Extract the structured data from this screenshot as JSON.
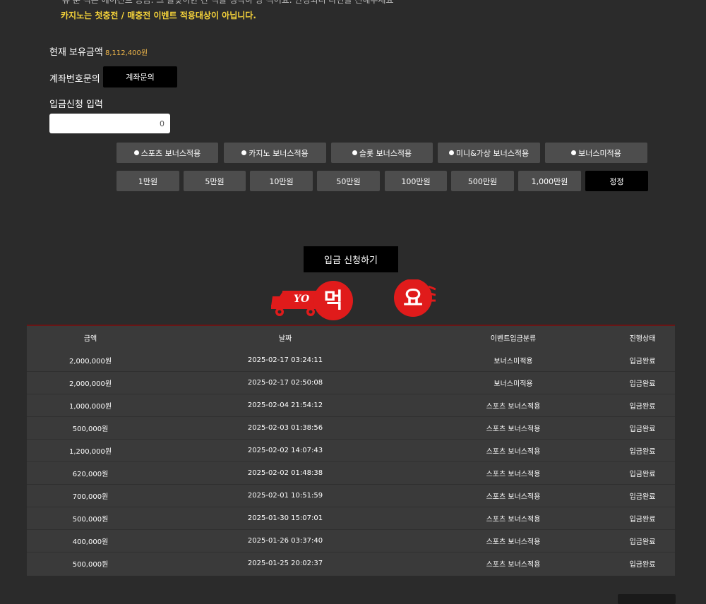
{
  "notice": {
    "line1": "유 분 적은 에이전트 공금. 그 을맞이한 간 적을 생각하 당 적어요. 안정되니 다면을 전해주세요",
    "line2": "카지노는 첫충전 / 매충전 이벤트 적용대상이 아닙니다."
  },
  "balance": {
    "label": "현재 보유금액",
    "value": "8,112,400원"
  },
  "account": {
    "label": "계좌번호문의",
    "button": "계좌문의"
  },
  "deposit": {
    "label": "입금신청 입력",
    "value": "0"
  },
  "bonus_options": [
    {
      "label": "스포츠 보너스적용"
    },
    {
      "label": "카지노 보너스적용"
    },
    {
      "label": "슬롯 보너스적용"
    },
    {
      "label": "미니&가상 보너스적용"
    },
    {
      "label": "보너스미적용"
    }
  ],
  "amount_buttons": [
    {
      "label": "1만원"
    },
    {
      "label": "5만원"
    },
    {
      "label": "10만원"
    },
    {
      "label": "50만원"
    },
    {
      "label": "100만원"
    },
    {
      "label": "500만원"
    },
    {
      "label": "1,000만원"
    },
    {
      "label": "정정"
    }
  ],
  "submit": {
    "label": "입금 신청하기"
  },
  "logo": {
    "yo": "YO",
    "meok": "먹",
    "yo_circle": "요"
  },
  "history": {
    "headers": {
      "amount": "금액",
      "date": "날짜",
      "event": "이벤트입금분류",
      "status": "진행상태"
    },
    "rows": [
      {
        "amount": "2,000,000원",
        "date": "2025-02-17 03:24:11",
        "event": "보너스미적용",
        "status": "입금완료"
      },
      {
        "amount": "2,000,000원",
        "date": "2025-02-17 02:50:08",
        "event": "보너스미적용",
        "status": "입금완료"
      },
      {
        "amount": "1,000,000원",
        "date": "2025-02-04 21:54:12",
        "event": "스포츠 보너스적용",
        "status": "입금완료"
      },
      {
        "amount": "500,000원",
        "date": "2025-02-03 01:38:56",
        "event": "스포츠 보너스적용",
        "status": "입금완료"
      },
      {
        "amount": "1,200,000원",
        "date": "2025-02-02 14:07:43",
        "event": "스포츠 보너스적용",
        "status": "입금완료"
      },
      {
        "amount": "620,000원",
        "date": "2025-02-02 01:48:38",
        "event": "스포츠 보너스적용",
        "status": "입금완료"
      },
      {
        "amount": "700,000원",
        "date": "2025-02-01 10:51:59",
        "event": "스포츠 보너스적용",
        "status": "입금완료"
      },
      {
        "amount": "500,000원",
        "date": "2025-01-30 15:07:01",
        "event": "스포츠 보너스적용",
        "status": "입금완료"
      },
      {
        "amount": "400,000원",
        "date": "2025-01-26 03:37:40",
        "event": "스포츠 보너스적용",
        "status": "입금완료"
      },
      {
        "amount": "500,000원",
        "date": "2025-01-25 20:02:37",
        "event": "스포츠 보너스적용",
        "status": "입금완료"
      }
    ]
  },
  "colors": {
    "accent_yellow": "#f4d23a",
    "balance_orange": "#f0b74a",
    "logo_red": "#e01b1b"
  }
}
